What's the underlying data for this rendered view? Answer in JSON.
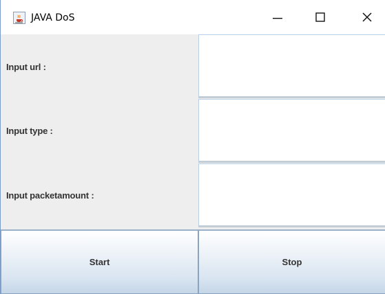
{
  "window": {
    "title": "JAVA DoS",
    "icon": "java-cup-icon",
    "controls": {
      "minimize_glyph": "—",
      "maximize_icon": "maximize-icon",
      "close_glyph": "✕"
    }
  },
  "form": {
    "url_label": "Input url :",
    "type_label": "Input type :",
    "packet_label": "Input packetamount :",
    "url_value": "",
    "type_value": "",
    "packet_value": ""
  },
  "buttons": {
    "start_label": "Start",
    "stop_label": "Stop"
  },
  "colors": {
    "panel_bg": "#eeeeee",
    "button_top": "#ffffff",
    "button_bottom": "#c5d6e8",
    "field_border": "#b8cfe5"
  }
}
